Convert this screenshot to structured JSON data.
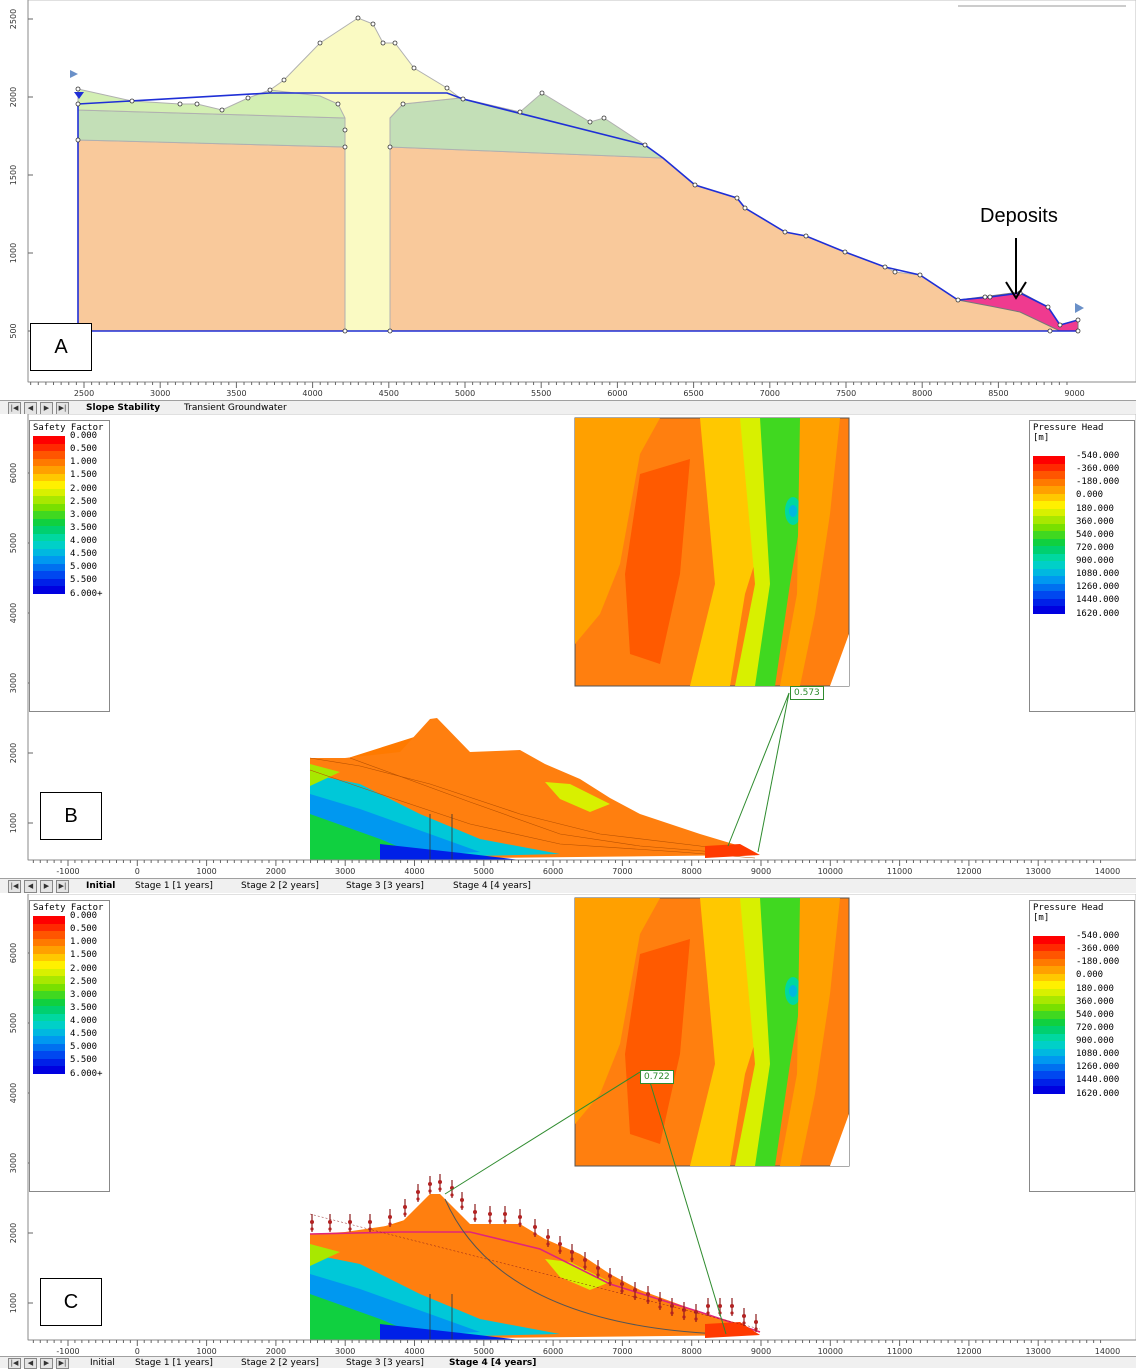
{
  "panelA": {
    "label": "A",
    "annotation": "Deposits",
    "x_ticks": [
      "2500",
      "3000",
      "3500",
      "4000",
      "4500",
      "5000",
      "5500",
      "6000",
      "6500",
      "7000",
      "7500",
      "8000",
      "8500",
      "9000"
    ],
    "y_ticks": [
      "500",
      "1000",
      "1500",
      "2000",
      "2500"
    ],
    "tabs": [
      "Slope Stability",
      "Transient Groundwater"
    ],
    "active_tab": 0,
    "colors": {
      "orange_layer": "#f9c99b",
      "green_layer": "#c3dfb7",
      "light_green": "#d3efb3",
      "yellow_layer": "#fafac3",
      "deposits": "#ef3a8f",
      "water_line": "#1f2fd6"
    }
  },
  "panelB": {
    "label": "B",
    "callout": "0.573",
    "tabs": [
      "Initial",
      "Stage 1 [1 years]",
      "Stage 2 [2 years]",
      "Stage 3 [3 years]",
      "Stage 4 [4 years]"
    ],
    "active_tab": 0
  },
  "panelC": {
    "label": "C",
    "callout": "0.722",
    "tabs": [
      "Initial",
      "Stage 1 [1 years]",
      "Stage 2 [2 years]",
      "Stage 3 [3 years]",
      "Stage 4 [4 years]"
    ],
    "active_tab": 4
  },
  "bottom_axes": {
    "x_ticks": [
      "-1000",
      "0",
      "1000",
      "2000",
      "3000",
      "4000",
      "5000",
      "6000",
      "7000",
      "8000",
      "9000",
      "10000",
      "11000",
      "12000",
      "13000",
      "14000"
    ],
    "y_ticks": [
      "1000",
      "2000",
      "3000",
      "4000",
      "5000",
      "6000"
    ]
  },
  "safety_legend": {
    "title": "Safety Factor",
    "values": [
      "0.000",
      "0.500",
      "1.000",
      "1.500",
      "2.000",
      "2.500",
      "3.000",
      "3.500",
      "4.000",
      "4.500",
      "5.000",
      "5.500",
      "6.000+"
    ],
    "colors": [
      "#ff0000",
      "#ff2a00",
      "#ff5500",
      "#ff7a00",
      "#ffa000",
      "#ffc800",
      "#fff000",
      "#d8f000",
      "#a8e800",
      "#78e000",
      "#40d820",
      "#10d040",
      "#00d070",
      "#00d8a0",
      "#00d0c8",
      "#00b8e0",
      "#0098f0",
      "#0070f0",
      "#0048f0",
      "#0020e8",
      "#0000e0"
    ]
  },
  "pressure_legend": {
    "title": "Pressure Head",
    "unit": "[m]",
    "values": [
      "-540.000",
      "-360.000",
      "-180.000",
      "0.000",
      "180.000",
      "360.000",
      "540.000",
      "720.000",
      "900.000",
      "1080.000",
      "1260.000",
      "1440.000",
      "1620.000"
    ],
    "colors": [
      "#ff0000",
      "#ff2a00",
      "#ff5500",
      "#ff7a00",
      "#ffa000",
      "#ffc800",
      "#fff000",
      "#d8f000",
      "#a8e800",
      "#78e000",
      "#40d820",
      "#10d040",
      "#00d070",
      "#00d8a0",
      "#00d0c8",
      "#00b8e0",
      "#0098f0",
      "#0070f0",
      "#0048f0",
      "#0020e8",
      "#0000e0"
    ]
  }
}
